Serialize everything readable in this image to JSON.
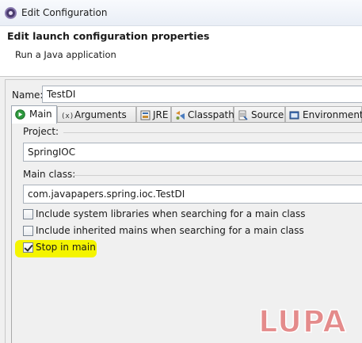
{
  "window": {
    "title": "Edit Configuration",
    "app_icon": "eclipse-icon"
  },
  "header": {
    "title": "Edit launch configuration properties",
    "subtitle": "Run a Java application"
  },
  "name_field": {
    "label": "Name:",
    "value": "TestDI"
  },
  "tabs": [
    {
      "label": "Main",
      "icon": "main-tab-icon",
      "active": true
    },
    {
      "label": "Arguments",
      "icon": "arguments-icon",
      "active": false
    },
    {
      "label": "JRE",
      "icon": "jre-icon",
      "active": false
    },
    {
      "label": "Classpath",
      "icon": "classpath-icon",
      "active": false
    },
    {
      "label": "Source",
      "icon": "source-icon",
      "active": false
    },
    {
      "label": "Environment",
      "icon": "environment-icon",
      "active": false
    }
  ],
  "main_tab": {
    "project": {
      "label": "Project:",
      "value": "SpringIOC"
    },
    "main_class": {
      "label": "Main class:",
      "value": "com.javapapers.spring.ioc.TestDI"
    },
    "options": [
      {
        "label": "Include system libraries when searching for a main class",
        "checked": false
      },
      {
        "label": "Include inherited mains when searching for a main class",
        "checked": false
      },
      {
        "label": "Stop in main",
        "checked": true
      }
    ]
  },
  "watermark": {
    "text": "LUPA",
    "color": "#e06a6a"
  },
  "colors": {
    "highlight": "#f4f400"
  }
}
